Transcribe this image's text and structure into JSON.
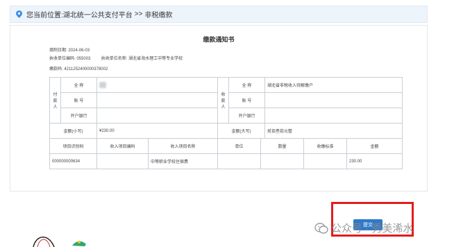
{
  "breadcrumb": {
    "prefix": "您当前位置:",
    "platform": "湖北统一公共支付平台",
    "separator": ">>",
    "current": "非税缴款"
  },
  "notice": {
    "title": "缴款通知书",
    "fill_date_label": "填制日期:",
    "fill_date": "2024-06-03",
    "agency_code_label": "执收单位编码:",
    "agency_code": "055003",
    "agency_name_label": "执收单位名称:",
    "agency_name": "湖北省海水理工中等专业学校",
    "pay_code_label": "缴款码:",
    "pay_code": "4211252400000378002"
  },
  "payer": {
    "group_label": "付款人",
    "name_label": "全 称",
    "account_label": "账 号",
    "bank_label": "开户银行"
  },
  "payee": {
    "group_label": "收款人",
    "name_label": "全 称",
    "name_value": "湖北省非税收入待解缴户",
    "account_label": "账 号",
    "bank_label": "开户银行"
  },
  "amount": {
    "small_label": "金额(小写)",
    "small_value": "¥230.00",
    "big_label": "金额(大写)",
    "big_value": "贰佰叁拾元整"
  },
  "items": {
    "headers": [
      "项目识别码",
      "收入项目编码",
      "收入项目名称",
      "单位",
      "数量",
      "收缴标准",
      "金额"
    ],
    "rows": [
      [
        "000000000634",
        "",
        "中等职业学校住宿费",
        "",
        "",
        "",
        "230.00"
      ]
    ]
  },
  "submit_label": "提交",
  "watermark_text": "公众号 · 秀美浠水"
}
